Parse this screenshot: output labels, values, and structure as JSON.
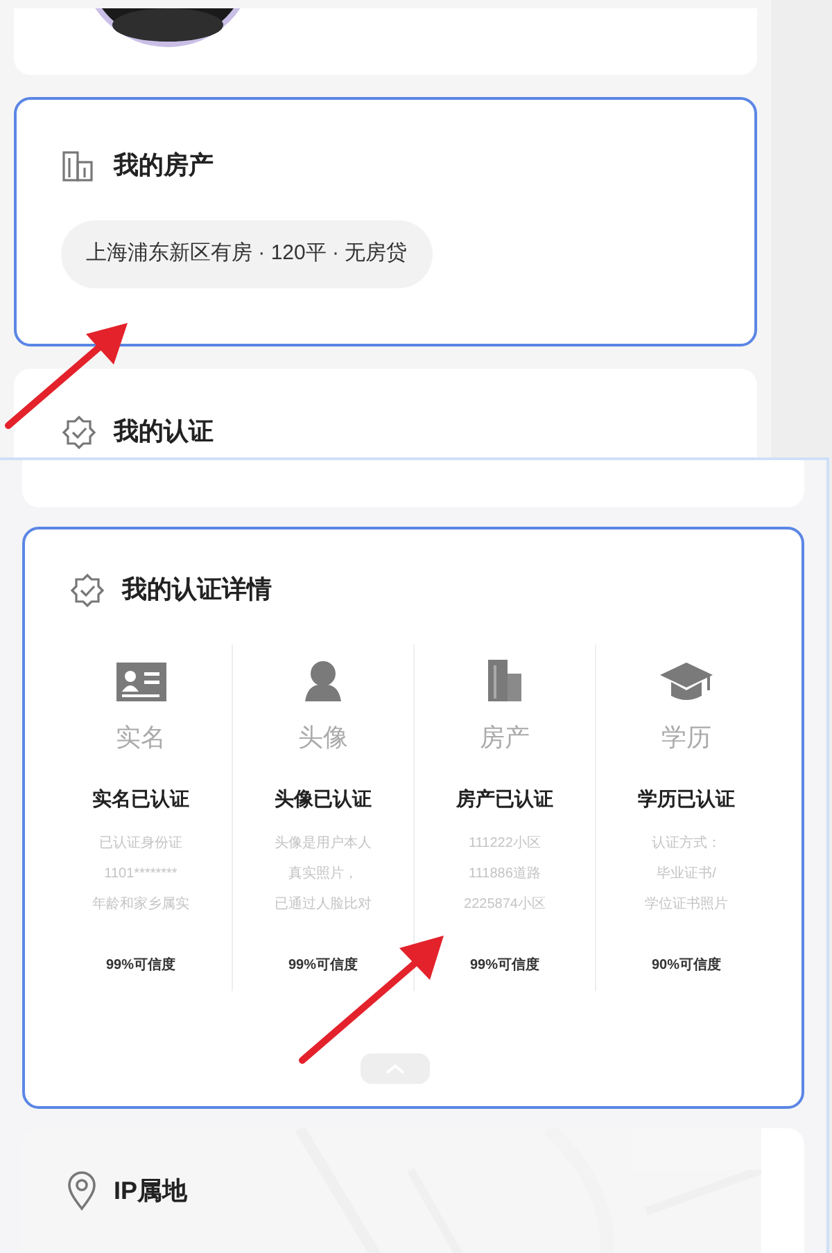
{
  "property_card": {
    "title": "我的房产",
    "tag": "上海浦东新区有房 · 120平 · 无房贷",
    "highlighted": true
  },
  "verification_card": {
    "title": "我的认证",
    "highlighted": false
  },
  "verification_detail": {
    "title": "我的认证详情",
    "highlighted": true,
    "items": [
      {
        "kind": "id",
        "label": "实名",
        "status": "实名已认证",
        "details": [
          "已认证身份证",
          "1101********",
          "年龄和家乡属实"
        ],
        "confidence": "99%可信度"
      },
      {
        "kind": "avatar",
        "label": "头像",
        "status": "头像已认证",
        "details": [
          "头像是用户本人",
          "真实照片，",
          "已通过人脸比对"
        ],
        "confidence": "99%可信度"
      },
      {
        "kind": "property",
        "label": "房产",
        "status": "房产已认证",
        "details": [
          "111222小区",
          "111886道路",
          "2225874小区"
        ],
        "confidence": "99%可信度"
      },
      {
        "kind": "education",
        "label": "学历",
        "status": "学历已认证",
        "details": [
          "认证方式：",
          "毕业证书/",
          "学位证书照片"
        ],
        "confidence": "90%可信度"
      }
    ]
  },
  "ip_card": {
    "title": "IP属地"
  }
}
